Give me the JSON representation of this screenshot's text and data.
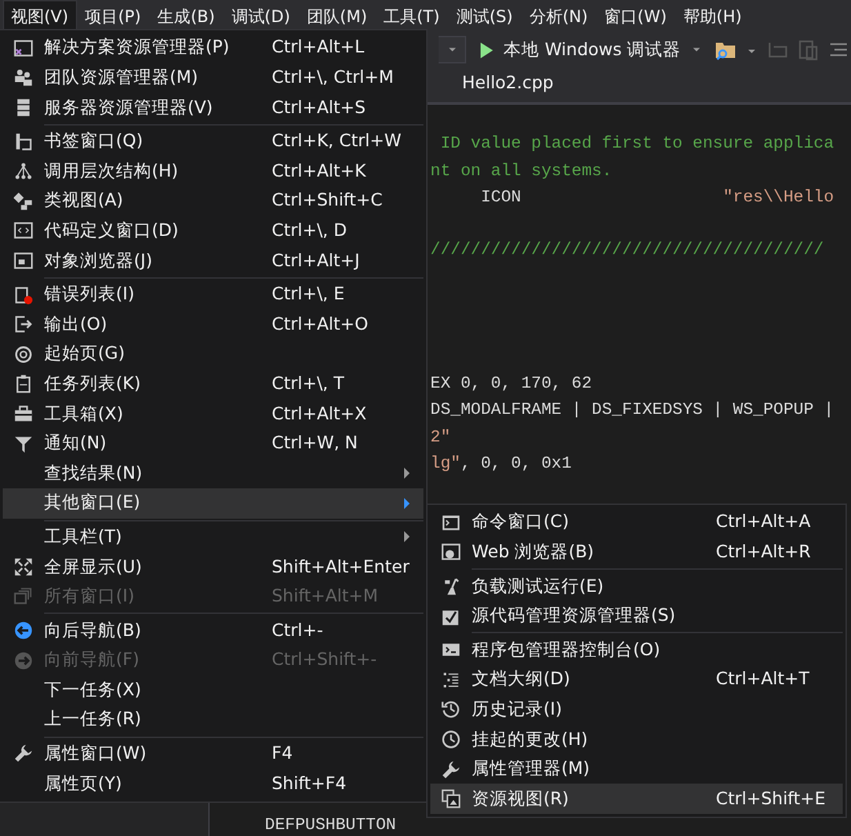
{
  "menu_bar": [
    {
      "label": "视图(V)",
      "selected": true
    },
    {
      "label": "项目(P)",
      "selected": false
    },
    {
      "label": "生成(B)",
      "selected": false
    },
    {
      "label": "调试(D)",
      "selected": false
    },
    {
      "label": "团队(M)",
      "selected": false
    },
    {
      "label": "工具(T)",
      "selected": false
    },
    {
      "label": "测试(S)",
      "selected": false
    },
    {
      "label": "分析(N)",
      "selected": false
    },
    {
      "label": "窗口(W)",
      "selected": false
    },
    {
      "label": "帮助(H)",
      "selected": false
    }
  ],
  "toolbar": {
    "debugger": "本地 Windows 调试器"
  },
  "editor": {
    "tab": "Hello2.cpp",
    "lines": [
      {
        "kind": "blank"
      },
      {
        "kind": "clipped",
        "segments": [
          {
            "kind": "comment",
            "text": " ID value placed first to ensure applica"
          }
        ]
      },
      {
        "kind": "clipped",
        "segments": [
          {
            "kind": "comment",
            "text": "nt on all systems."
          }
        ]
      },
      {
        "kind": "clipped",
        "segments": [
          {
            "kind": "plain",
            "text": "     ICON                    "
          },
          {
            "kind": "string",
            "text": "\"res\\\\Hello"
          }
        ]
      },
      {
        "kind": "blank"
      },
      {
        "kind": "clipped",
        "segments": [
          {
            "kind": "comment",
            "text": "///////////////////////////////////////"
          }
        ]
      },
      {
        "kind": "blank"
      },
      {
        "kind": "blank"
      },
      {
        "kind": "blank"
      },
      {
        "kind": "blank"
      },
      {
        "kind": "clipped",
        "segments": [
          {
            "kind": "plain",
            "text": "EX 0, 0, 170, 62"
          }
        ]
      },
      {
        "kind": "clipped",
        "segments": [
          {
            "kind": "plain",
            "text": "DS_MODALFRAME | DS_FIXEDSYS | WS_POPUP |"
          }
        ]
      },
      {
        "kind": "clipped",
        "segments": [
          {
            "kind": "string",
            "text": "2\""
          }
        ]
      },
      {
        "kind": "clipped",
        "segments": [
          {
            "kind": "string",
            "text": "lg\""
          },
          {
            "kind": "plain",
            "text": ", 0, 0, 0x1"
          }
        ]
      },
      {
        "kind": "open",
        "segments": [
          {
            "kind": "plain",
            "text": "DEFPUSHBUTTON"
          }
        ]
      }
    ]
  },
  "view_menu": [
    {
      "kind": "item",
      "label": "解决方案资源管理器(P)",
      "shortcut": "Ctrl+Alt+L",
      "disabled": false,
      "selected": false,
      "submenu": false
    },
    {
      "kind": "item",
      "label": "团队资源管理器(M)",
      "shortcut": "Ctrl+\\, Ctrl+M",
      "disabled": false,
      "selected": false,
      "submenu": false
    },
    {
      "kind": "item",
      "label": "服务器资源管理器(V)",
      "shortcut": "Ctrl+Alt+S",
      "disabled": false,
      "selected": false,
      "submenu": false
    },
    {
      "kind": "separator"
    },
    {
      "kind": "item",
      "label": "书签窗口(Q)",
      "shortcut": "Ctrl+K, Ctrl+W",
      "disabled": false,
      "selected": false,
      "submenu": false
    },
    {
      "kind": "item",
      "label": "调用层次结构(H)",
      "shortcut": "Ctrl+Alt+K",
      "disabled": false,
      "selected": false,
      "submenu": false
    },
    {
      "kind": "item",
      "label": "类视图(A)",
      "shortcut": "Ctrl+Shift+C",
      "disabled": false,
      "selected": false,
      "submenu": false
    },
    {
      "kind": "item",
      "label": "代码定义窗口(D)",
      "shortcut": "Ctrl+\\, D",
      "disabled": false,
      "selected": false,
      "submenu": false
    },
    {
      "kind": "item",
      "label": "对象浏览器(J)",
      "shortcut": "Ctrl+Alt+J",
      "disabled": false,
      "selected": false,
      "submenu": false
    },
    {
      "kind": "separator"
    },
    {
      "kind": "item",
      "label": "错误列表(I)",
      "shortcut": "Ctrl+\\, E",
      "disabled": false,
      "selected": false,
      "submenu": false
    },
    {
      "kind": "item",
      "label": "输出(O)",
      "shortcut": "Ctrl+Alt+O",
      "disabled": false,
      "selected": false,
      "submenu": false
    },
    {
      "kind": "item",
      "label": "起始页(G)",
      "disabled": false,
      "selected": false,
      "submenu": false
    },
    {
      "kind": "item",
      "label": "任务列表(K)",
      "shortcut": "Ctrl+\\, T",
      "disabled": false,
      "selected": false,
      "submenu": false
    },
    {
      "kind": "item",
      "label": "工具箱(X)",
      "shortcut": "Ctrl+Alt+X",
      "disabled": false,
      "selected": false,
      "submenu": false
    },
    {
      "kind": "item",
      "label": "通知(N)",
      "shortcut": "Ctrl+W, N",
      "disabled": false,
      "selected": false,
      "submenu": false
    },
    {
      "kind": "item",
      "label": "查找结果(N)",
      "disabled": false,
      "selected": false,
      "submenu": true
    },
    {
      "kind": "item",
      "label": "其他窗口(E)",
      "disabled": false,
      "selected": true,
      "submenu": true
    },
    {
      "kind": "separator"
    },
    {
      "kind": "item",
      "label": "工具栏(T)",
      "disabled": false,
      "selected": false,
      "submenu": true
    },
    {
      "kind": "item",
      "label": "全屏显示(U)",
      "shortcut": "Shift+Alt+Enter",
      "disabled": false,
      "selected": false,
      "submenu": false
    },
    {
      "kind": "item",
      "label": "所有窗口(I)",
      "shortcut": "Shift+Alt+M",
      "disabled": true,
      "selected": false,
      "submenu": false
    },
    {
      "kind": "separator"
    },
    {
      "kind": "item",
      "label": "向后导航(B)",
      "shortcut": "Ctrl+-",
      "disabled": false,
      "selected": false,
      "submenu": false
    },
    {
      "kind": "item",
      "label": "向前导航(F)",
      "shortcut": "Ctrl+Shift+-",
      "disabled": true,
      "selected": false,
      "submenu": false
    },
    {
      "kind": "item",
      "label": "下一任务(X)",
      "disabled": false,
      "selected": false,
      "submenu": false
    },
    {
      "kind": "item",
      "label": "上一任务(R)",
      "disabled": false,
      "selected": false,
      "submenu": false
    },
    {
      "kind": "separator"
    },
    {
      "kind": "item",
      "label": "属性窗口(W)",
      "shortcut": "F4",
      "disabled": false,
      "selected": false,
      "submenu": false
    },
    {
      "kind": "item",
      "label": "属性页(Y)",
      "shortcut": "Shift+F4",
      "disabled": false,
      "selected": false,
      "submenu": false
    }
  ],
  "other_windows_menu": [
    {
      "kind": "item",
      "label": "命令窗口(C)",
      "shortcut": "Ctrl+Alt+A",
      "selected": false
    },
    {
      "kind": "item",
      "label": "Web 浏览器(B)",
      "shortcut": "Ctrl+Alt+R",
      "selected": false
    },
    {
      "kind": "separator"
    },
    {
      "kind": "item",
      "label": "负载测试运行(E)",
      "selected": false
    },
    {
      "kind": "item",
      "label": "源代码管理资源管理器(S)",
      "selected": false
    },
    {
      "kind": "separator"
    },
    {
      "kind": "item",
      "label": "程序包管理器控制台(O)",
      "selected": false
    },
    {
      "kind": "item",
      "label": "文档大纲(D)",
      "shortcut": "Ctrl+Alt+T",
      "selected": false
    },
    {
      "kind": "item",
      "label": "历史记录(I)",
      "selected": false
    },
    {
      "kind": "item",
      "label": "挂起的更改(H)",
      "selected": false
    },
    {
      "kind": "item",
      "label": "属性管理器(M)",
      "selected": false
    },
    {
      "kind": "item",
      "label": "资源视图(R)",
      "shortcut": "Ctrl+Shift+E",
      "selected": true
    }
  ]
}
